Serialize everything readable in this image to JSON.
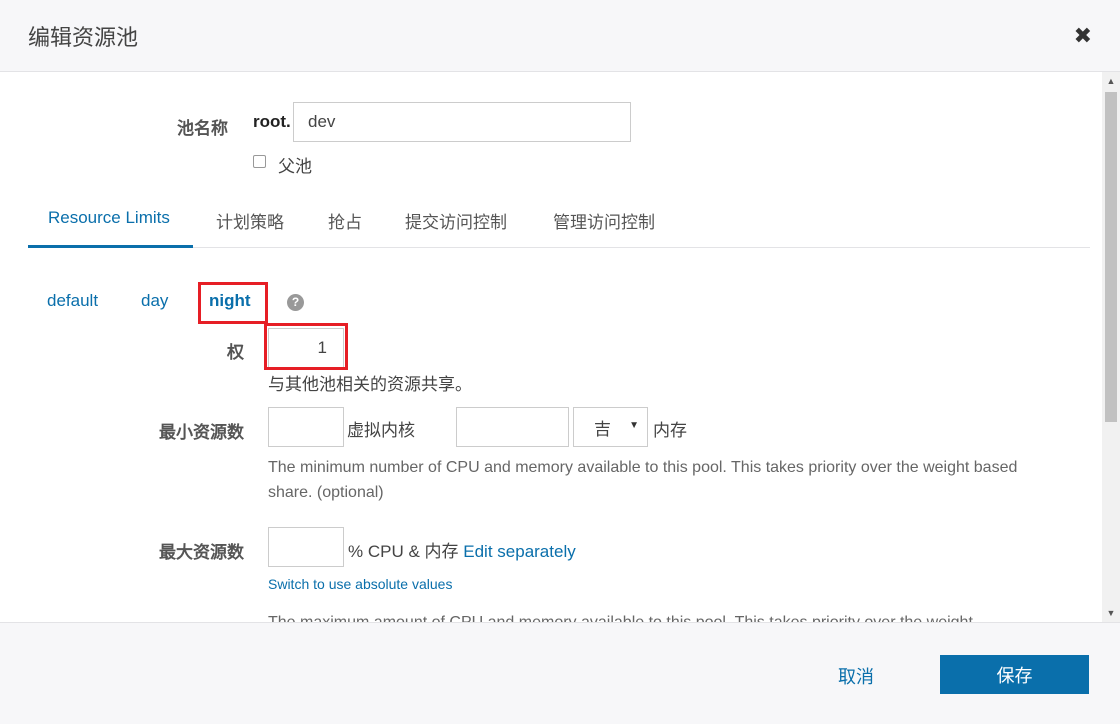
{
  "dialog": {
    "title": "编辑资源池",
    "close_icon": "close-icon"
  },
  "pool_name": {
    "label": "池名称",
    "prefix": "root.",
    "value": "dev",
    "parent_checkbox_label": "父池",
    "parent_checked": false
  },
  "tabs": [
    {
      "label": "Resource Limits",
      "active": true
    },
    {
      "label": "计划策略",
      "active": false
    },
    {
      "label": "抢占",
      "active": false
    },
    {
      "label": "提交访问控制",
      "active": false
    },
    {
      "label": "管理访问控制",
      "active": false
    }
  ],
  "schedules": [
    {
      "label": "default",
      "active": false
    },
    {
      "label": "day",
      "active": false
    },
    {
      "label": "night",
      "active": true
    }
  ],
  "help_icon": "question-circle-icon",
  "weight": {
    "label": "权",
    "value": "1",
    "help": "与其他池相关的资源共享。"
  },
  "min_resources": {
    "label": "最小资源数",
    "vcores_value": "",
    "vcores_unit": "虚拟内核",
    "memory_value": "",
    "memory_unit_selected": "吉",
    "memory_label": "内存",
    "help": "The minimum number of CPU and memory available to this pool. This takes priority over the weight based share. (optional)"
  },
  "max_resources": {
    "label": "最大资源数",
    "value": "",
    "unit_text": "% CPU & 内存",
    "edit_link": "Edit separately",
    "switch_link": "Switch to use absolute values",
    "help_partial": "The maximum amount of CPU and memory available to this pool. This takes priority over the weight"
  },
  "footer": {
    "cancel_label": "取消",
    "save_label": "保存"
  },
  "colors": {
    "accent": "#0a6fab",
    "highlight": "#e61e25"
  }
}
